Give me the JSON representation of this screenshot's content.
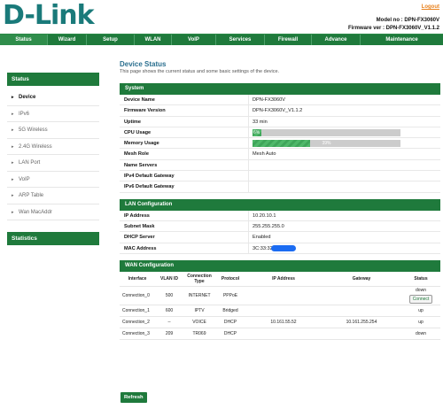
{
  "header": {
    "brand": "D-Link",
    "logout": "Logout",
    "model_label": "Model no : DPN-FX3060V",
    "firmware_label": "Firmware ver : DPN-FX3060V_V1.1.2"
  },
  "topnav": {
    "tabs": [
      "Status",
      "Wizard",
      "Setup",
      "WLAN",
      "VoIP",
      "Services",
      "Firewall",
      "Advance",
      "Maintenance"
    ],
    "active": "Status"
  },
  "sidebar": {
    "heading": "Status",
    "items": [
      "Device",
      "IPv6",
      "5G Wireless",
      "2.4G Wireless",
      "LAN Port",
      "VoIP",
      "ARP Table",
      "Wan MacAddr"
    ],
    "active_item": "Device",
    "statistics": "Statistics"
  },
  "page": {
    "title": "Device Status",
    "description": "This page shows the current status and some basic settings of the device."
  },
  "system": {
    "heading": "System",
    "rows": [
      {
        "key": "Device Name",
        "value": "DPN-FX3060V"
      },
      {
        "key": "Firmware Version",
        "value": "DPN-FX3060V_V1.1.2"
      },
      {
        "key": "Uptime",
        "value": "33 min"
      },
      {
        "key": "CPU Usage",
        "value": "6%"
      },
      {
        "key": "Memory Usage",
        "value": "39%"
      },
      {
        "key": "Mesh Role",
        "value": "Mesh Auto"
      },
      {
        "key": "Name Servers",
        "value": ""
      },
      {
        "key": "IPv4 Default Gateway",
        "value": ""
      },
      {
        "key": "IPv6 Default Gateway",
        "value": ""
      }
    ],
    "cpu_percent": 6,
    "memory_percent": 39,
    "bar_color": "#4fb86a"
  },
  "lan": {
    "heading": "LAN Configuration",
    "rows": [
      {
        "key": "IP Address",
        "value": "10.20.10.1"
      },
      {
        "key": "Subnet Mask",
        "value": "255.255.255.0"
      },
      {
        "key": "DHCP Server",
        "value": "Enabled"
      },
      {
        "key": "MAC Address",
        "value": "3C:33:32"
      }
    ]
  },
  "wan": {
    "heading": "WAN Configuration",
    "columns": [
      "Interface",
      "VLAN ID",
      "Connection Type",
      "Protocol",
      "IP Address",
      "Gateway",
      "Status"
    ],
    "rows": [
      [
        "Connection_0",
        "500",
        "INTERNET",
        "PPPoE",
        "",
        "",
        "down"
      ],
      [
        "Connection_1",
        "600",
        "IPTV",
        "Bridged",
        "",
        "",
        "up"
      ],
      [
        "Connection_2",
        "--",
        "VOICE",
        "DHCP",
        "10.161.55.52",
        "10.161.255.254",
        "up"
      ],
      [
        "Connection_3",
        "209",
        "TR069",
        "DHCP",
        "",
        "",
        "down"
      ]
    ],
    "connect_label": "Connect"
  },
  "actions": {
    "refresh": "Refresh"
  },
  "colors": {
    "brand_teal": "#1a7a7a",
    "nav_green": "#1f7a3c",
    "logout_orange": "#e8821e",
    "title_blue": "#2a6f8f",
    "redaction_blue": "#1b6cf2"
  }
}
